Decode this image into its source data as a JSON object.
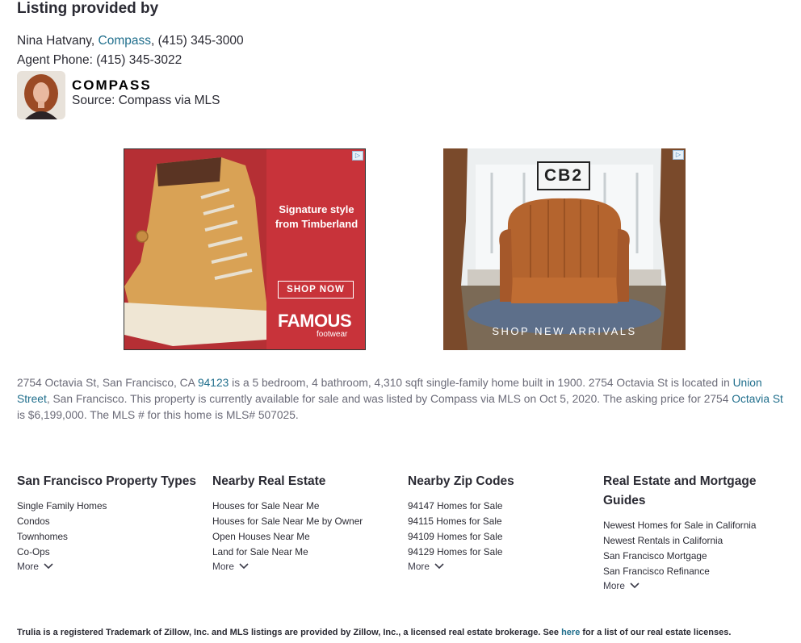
{
  "listing": {
    "heading": "Listing provided by",
    "agent_name": "Nina Hatvany, ",
    "brokerage": "Compass",
    "brokerage_phone": ", (415) 345-3000",
    "agent_phone_label": "Agent Phone: ",
    "agent_phone": "(415) 345-3022",
    "logo_text": "COMPASS",
    "source": "Source: Compass via MLS"
  },
  "ads": [
    {
      "tagline": "Signature style from Timberland",
      "cta": "SHOP NOW",
      "brand": "FAMOUS",
      "brand_sub": "footwear"
    },
    {
      "brand": "CB2",
      "cta": "SHOP NEW ARRIVALS"
    }
  ],
  "description": {
    "p1": "2754 Octavia St, San Francisco, CA ",
    "zip_link": "94123",
    "p2": " is a 5 bedroom, 4 bathroom, 4,310 sqft single-family home built in 1900. 2754 Octavia St is located in ",
    "neighborhood_link": "Union Street",
    "p3": ", San Francisco. This property is currently available for sale and was listed by Compass via MLS on Oct 5, 2020. The asking price for 2754 ",
    "street_link": "Octavia St",
    "p4": " is $6,199,000. The MLS # for this home is MLS# 507025."
  },
  "columns": [
    {
      "title": "San Francisco Property Types",
      "items": [
        "Single Family Homes",
        "Condos",
        "Townhomes",
        "Co-Ops"
      ],
      "more": "More"
    },
    {
      "title": "Nearby Real Estate",
      "items": [
        "Houses for Sale Near Me",
        "Houses for Sale Near Me by Owner",
        "Open Houses Near Me",
        "Land for Sale Near Me"
      ],
      "more": "More"
    },
    {
      "title": "Nearby Zip Codes",
      "items": [
        "94147 Homes for Sale",
        "94115 Homes for Sale",
        "94109 Homes for Sale",
        "94129 Homes for Sale"
      ],
      "more": "More"
    },
    {
      "title": "Real Estate and Mortgage Guides",
      "items": [
        "Newest Homes for Sale in California",
        "Newest Rentals in California",
        "San Francisco Mortgage",
        "San Francisco Refinance"
      ],
      "more": "More"
    }
  ],
  "footer": {
    "text_before": "Trulia is a registered Trademark of Zillow, Inc. and MLS listings are provided by Zillow, Inc., a licensed real estate brokerage. See ",
    "link": "here",
    "text_after": " for a list of our real estate licenses."
  }
}
